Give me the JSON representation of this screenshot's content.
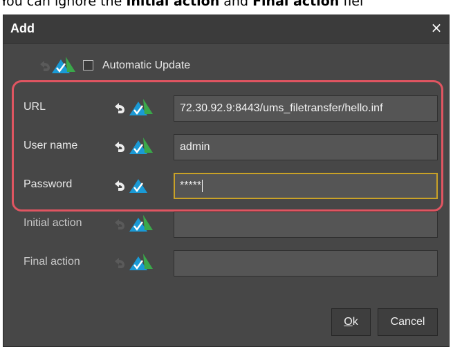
{
  "doc_snippet": {
    "prefix": "You can ignore the ",
    "bold1": "Initial action",
    "middle": " and ",
    "bold2": "Final action",
    "suffix": " fiel"
  },
  "dialog": {
    "title": "Add",
    "close_glyph": "×",
    "auto_update_label": "Automatic Update",
    "auto_update_checked": false,
    "rows": [
      {
        "label": "URL",
        "value": "72.30.92.9:8443/ums_filetransfer/hello.inf",
        "active": true
      },
      {
        "label": "User name",
        "value": "admin",
        "active": true
      },
      {
        "label": "Password",
        "value": "*****",
        "active": true,
        "focused": true
      },
      {
        "label": "Initial action",
        "value": "",
        "active": false
      },
      {
        "label": "Final action",
        "value": "",
        "active": false
      }
    ],
    "ok_label": "Ok",
    "ok_mnemonic": "O",
    "ok_rest": "k",
    "cancel_label": "Cancel"
  },
  "colors": {
    "dialog_bg": "#474747",
    "titlebar_bg": "#3b3b3b",
    "field_bg": "#555555",
    "focus_border": "#c9a227",
    "highlight_border": "#e05561",
    "icon_blue": "#1a9ad6",
    "icon_green": "#3aa84a"
  },
  "icons": {
    "reset": "undo-arrow-icon",
    "apply": "blue-green-triangle-check-icon"
  }
}
